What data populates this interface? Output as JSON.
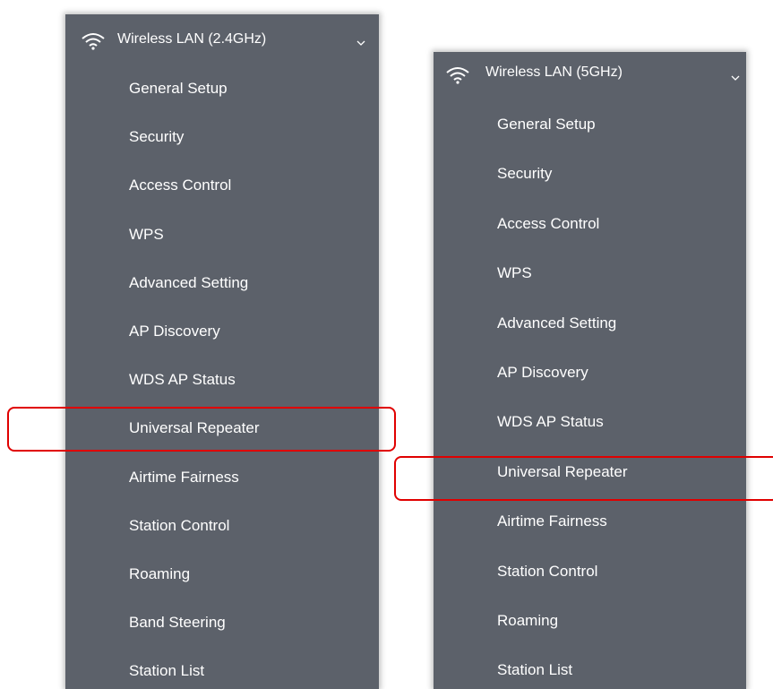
{
  "left_menu": {
    "header": "Wireless LAN (2.4GHz)",
    "items": [
      "General Setup",
      "Security",
      "Access Control",
      "WPS",
      "Advanced Setting",
      "AP Discovery",
      "WDS AP Status",
      "Universal Repeater",
      "Airtime Fairness",
      "Station Control",
      "Roaming",
      "Band Steering",
      "Station List"
    ]
  },
  "right_menu": {
    "header": "Wireless LAN (5GHz)",
    "items": [
      "General Setup",
      "Security",
      "Access Control",
      "WPS",
      "Advanced Setting",
      "AP Discovery",
      "WDS AP Status",
      "Universal Repeater",
      "Airtime Fairness",
      "Station Control",
      "Roaming",
      "Station List"
    ]
  },
  "highlighted_item": "Universal Repeater",
  "colors": {
    "panel_background": "#5c616a",
    "text": "#ffffff",
    "highlight_border": "#e00000"
  },
  "icons": {
    "header_icon": "wifi-icon",
    "expand_icon": "chevron-down-icon"
  }
}
